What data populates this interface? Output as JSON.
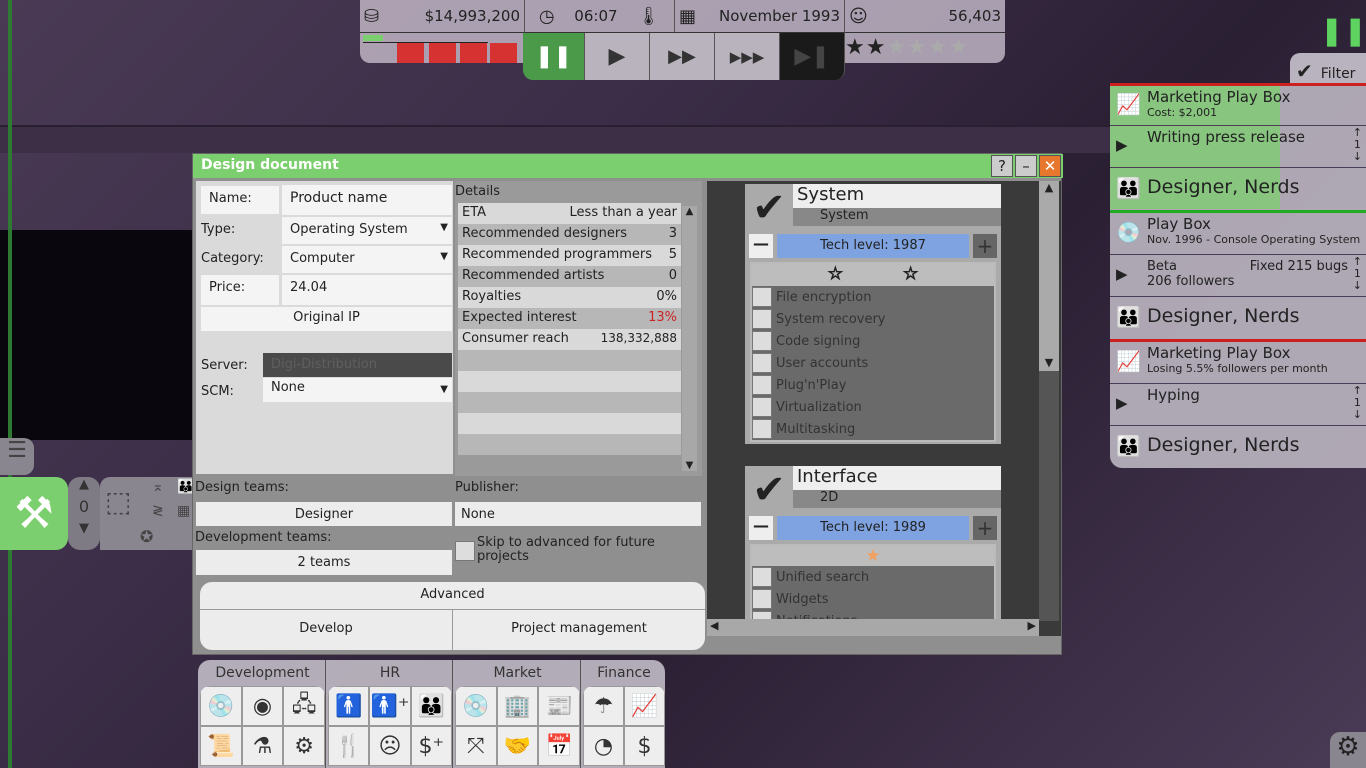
{
  "topbar": {
    "money": "$14,993,200",
    "time": "06:07",
    "date": "November 1993",
    "followers": "56,403",
    "rating_stars": 2,
    "rating_max": 6,
    "progress_fraction": 0.35,
    "accent": "#4a9a4a"
  },
  "speed": {
    "pause": "❚❚",
    "play": "▶",
    "fast": "▶▶",
    "faster": "▶▶▶",
    "skip": "▶❚"
  },
  "filter": {
    "label": "Filter"
  },
  "projects": [
    {
      "title": "Marketing Play Box",
      "subtitle": "Cost: $2,001",
      "task": "Writing press release",
      "task_right": "",
      "task_sub": "",
      "priority": "1",
      "team": "Designer, Nerds",
      "icon": "chart-icon",
      "bar_color": "#cc1f1f",
      "progress": 0.55
    },
    {
      "title": "Play Box",
      "subtitle": "Nov. 1996 - Console Operating System",
      "task": "Beta",
      "task_right": "Fixed 215 bugs",
      "task_sub": "206 followers",
      "priority": "1",
      "team": "Designer, Nerds",
      "icon": "disc-icon",
      "bar_color": "#22aa22"
    },
    {
      "title": "Marketing Play Box",
      "subtitle": "Losing 5.5% followers per month",
      "task": "Hyping",
      "task_right": "",
      "task_sub": "",
      "priority": "1",
      "team": "Designer, Nerds",
      "icon": "chart-icon",
      "bar_color": "#cc1f1f"
    }
  ],
  "dialog": {
    "title": "Design document",
    "help": "?",
    "minimize": "–",
    "close": "✕",
    "name_label": "Name:",
    "name_value": "Product name",
    "type_label": "Type:",
    "type_value": "Operating System",
    "category_label": "Category:",
    "category_value": "Computer",
    "price_label": "Price:",
    "price_value": "24.04",
    "original_ip": "Original IP",
    "server_label": "Server:",
    "server_placeholder": "Digi-Distribution",
    "scm_label": "SCM:",
    "scm_value": "None",
    "details_label": "Details",
    "details": [
      {
        "k": "ETA",
        "v": "Less than a year"
      },
      {
        "k": "Recommended designers",
        "v": "3"
      },
      {
        "k": "Recommended programmers",
        "v": "5"
      },
      {
        "k": "Recommended artists",
        "v": "0"
      },
      {
        "k": "Royalties",
        "v": "0%"
      },
      {
        "k": "Expected interest",
        "v": "13%",
        "color": "#cc2222"
      },
      {
        "k": "Consumer reach",
        "v": "138,332,888"
      }
    ],
    "design_teams_label": "Design teams:",
    "design_teams_value": "Designer",
    "dev_teams_label": "Development teams:",
    "dev_teams_value": "2 teams",
    "publisher_label": "Publisher:",
    "publisher_value": "None",
    "skip_label": "Skip to advanced for future projects",
    "advanced": "Advanced",
    "develop": "Develop",
    "project_management": "Project management",
    "features": [
      {
        "title": "System",
        "subtitle": "System",
        "tech": "Tech level: 1987",
        "stars": 2,
        "items": [
          "File encryption",
          "System recovery",
          "Code signing",
          "User accounts",
          "Plug'n'Play",
          "Virtualization",
          "Multitasking"
        ]
      },
      {
        "title": "Interface",
        "subtitle": "2D",
        "tech": "Tech level: 1989",
        "stars": 1,
        "items": [
          "Unified search",
          "Widgets",
          "Notifications"
        ]
      }
    ]
  },
  "leftbar": {
    "counter": "0"
  },
  "toolbar": {
    "sections": [
      "Development",
      "HR",
      "Market",
      "Finance"
    ]
  }
}
